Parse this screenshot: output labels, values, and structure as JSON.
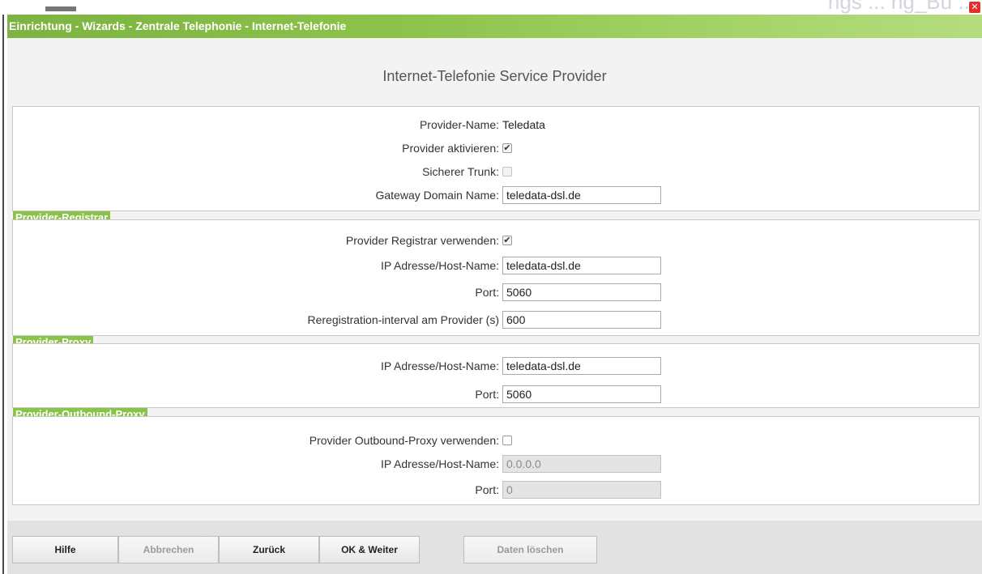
{
  "background": {
    "text": "ngs ... ng_Bu ..."
  },
  "window": {
    "title": "Einrichtung - Wizards - Zentrale Telephonie - Internet-Telefonie",
    "close_icon": "close-icon"
  },
  "page": {
    "heading": "Internet-Telefonie Service Provider"
  },
  "general": {
    "provider_name_label": "Provider-Name:",
    "provider_name_value": "Teledata",
    "provider_activate_label": "Provider aktivieren:",
    "provider_activate_checked": true,
    "secure_trunk_label": "Sicherer Trunk:",
    "secure_trunk_checked": false,
    "gateway_domain_label": "Gateway Domain Name:",
    "gateway_domain_value": "teledata-dsl.de"
  },
  "registrar": {
    "section_title": "Provider-Registrar",
    "use_label": "Provider Registrar verwenden:",
    "use_checked": true,
    "host_label": "IP Adresse/Host-Name:",
    "host_value": "teledata-dsl.de",
    "port_label": "Port:",
    "port_value": "5060",
    "interval_label": "Reregistration-interval am Provider (s)",
    "interval_value": "600"
  },
  "proxy": {
    "section_title": "Provider-Proxy",
    "host_label": "IP Adresse/Host-Name:",
    "host_value": "teledata-dsl.de",
    "port_label": "Port:",
    "port_value": "5060"
  },
  "outbound_proxy": {
    "section_title": "Provider-Outbound-Proxy",
    "use_label": "Provider Outbound-Proxy verwenden:",
    "use_checked": false,
    "host_label": "IP Adresse/Host-Name:",
    "host_value": "0.0.0.0",
    "port_label": "Port:",
    "port_value": "0"
  },
  "buttons": {
    "help": "Hilfe",
    "cancel": "Abbrechen",
    "back": "Zurück",
    "ok_next": "OK & Weiter",
    "delete_data": "Daten löschen"
  },
  "colors": {
    "accent_green": "#8bc34a",
    "close_red": "#e0312c"
  }
}
